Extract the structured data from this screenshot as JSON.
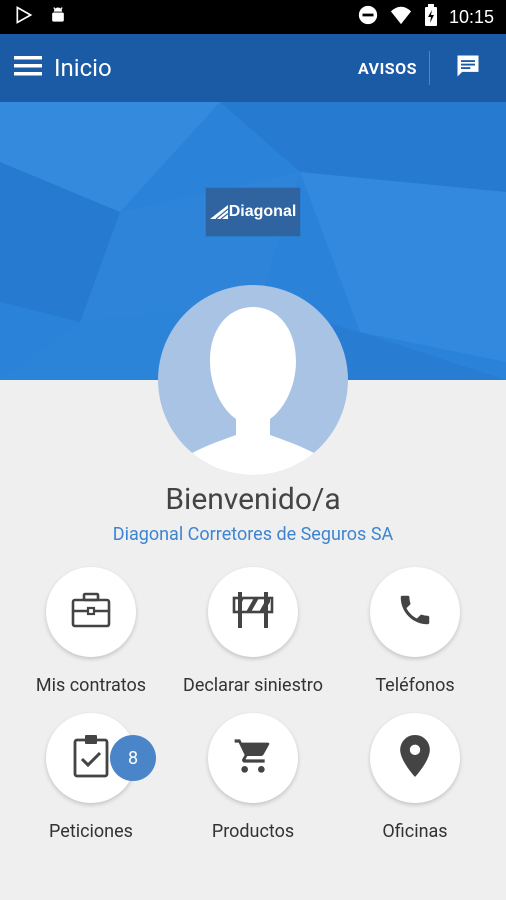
{
  "status_bar": {
    "time": "10:15"
  },
  "app_bar": {
    "title": "Inicio",
    "avisos_label": "AVISOS"
  },
  "banner": {
    "logo_text": "Diagonal"
  },
  "profile": {
    "welcome": "Bienvenido/a",
    "company": "Diagonal Corretores de Seguros SA"
  },
  "menu": {
    "items": [
      {
        "label": "Mis contratos",
        "icon": "briefcase-icon"
      },
      {
        "label": "Declarar siniestro",
        "icon": "barrier-icon"
      },
      {
        "label": "Teléfonos",
        "icon": "phone-icon"
      },
      {
        "label": "Peticiones",
        "icon": "clipboard-check-icon",
        "badge": "8"
      },
      {
        "label": "Productos",
        "icon": "cart-icon"
      },
      {
        "label": "Oficinas",
        "icon": "location-pin-icon"
      }
    ]
  },
  "colors": {
    "appbar": "#1b5aa5",
    "banner": "#2b82d9",
    "accent": "#3d85d1",
    "badge": "#4a84c9"
  }
}
